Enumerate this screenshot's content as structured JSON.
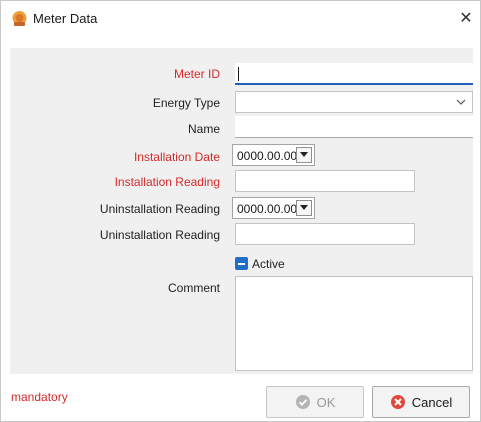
{
  "window": {
    "title": "Meter Data",
    "close_glyph": "✕",
    "icon": "meter-app-icon"
  },
  "form": {
    "meter_id": {
      "label": "Meter ID",
      "value": "",
      "required": true
    },
    "energy_type": {
      "label": "Energy Type",
      "value": "",
      "required": false
    },
    "name": {
      "label": "Name",
      "value": "",
      "required": false
    },
    "installation_date": {
      "label": "Installation Date",
      "value": "0000.00.00",
      "required": true
    },
    "installation_reading": {
      "label": "Installation Reading",
      "value": "",
      "required": true
    },
    "uninstallation_date": {
      "label": "Uninstallation Reading",
      "value": "0000.00.00",
      "required": false
    },
    "uninstallation_reading": {
      "label": "Uninstallation Reading",
      "value": "",
      "required": false
    },
    "active": {
      "label": "Active",
      "state": "indeterminate"
    },
    "comment": {
      "label": "Comment",
      "value": ""
    }
  },
  "footer": {
    "mandatory_text": "mandatory",
    "ok_label": "OK",
    "cancel_label": "Cancel"
  },
  "colors": {
    "required": "#d42a2a",
    "accent": "#1f6fc8",
    "cancel_icon": "#e2473d",
    "panel_bg": "#f0f0f0"
  }
}
